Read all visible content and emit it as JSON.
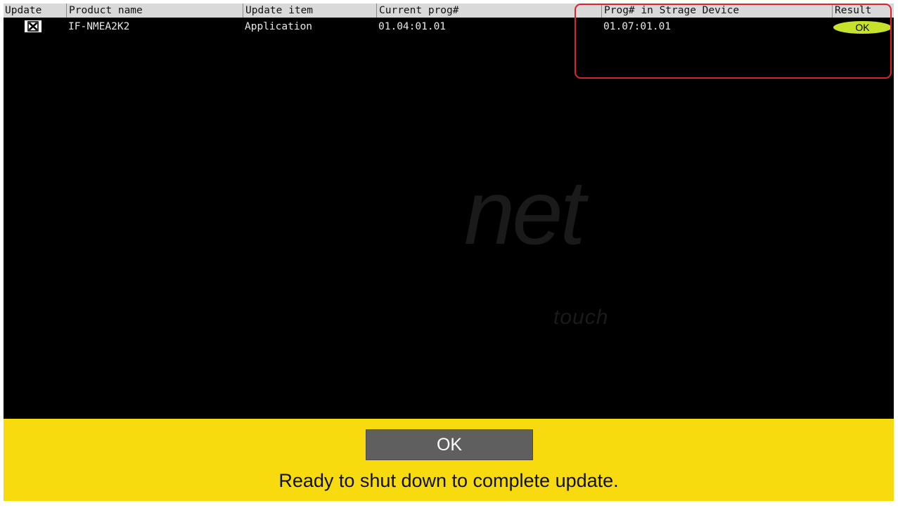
{
  "table": {
    "headers": {
      "update": "Update",
      "product_name": "Product name",
      "update_item": "Update item",
      "current_prog": "Current prog#",
      "prog_in_storage": "Prog# in Strage Device",
      "result": "Result"
    },
    "rows": [
      {
        "update_checked": true,
        "product_name": "IF-NMEA2K2",
        "update_item": "Application",
        "current_prog": "01.04:01.01",
        "prog_in_storage": "01.07:01.01",
        "result": "OK"
      }
    ]
  },
  "logo": {
    "main": "net",
    "sub": "touch"
  },
  "footer": {
    "ok_button": "OK",
    "message": "Ready to shut down to complete update."
  },
  "colors": {
    "screen_bg": "#000000",
    "header_bg": "#d9d9d9",
    "footer_bg": "#f8db0f",
    "ok_pill": "#c6e22a",
    "highlight_border": "#e0202a",
    "ok_button_bg": "#5f5f5f"
  }
}
